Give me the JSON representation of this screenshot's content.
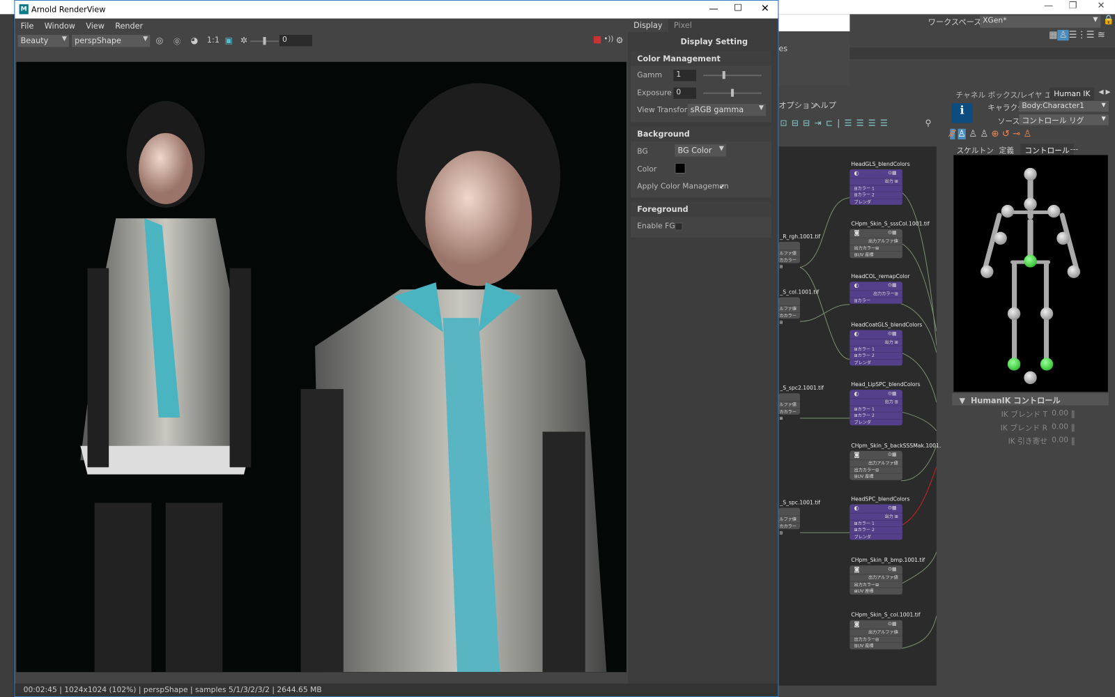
{
  "render_view": {
    "title": "Arnold RenderView",
    "window_controls": [
      "—",
      "☐",
      "✕"
    ],
    "menu": [
      "File",
      "Window",
      "View",
      "Render"
    ],
    "toolbar": {
      "aov": "Beauty",
      "camera": "perspShape",
      "ratio": "1:1",
      "exposure_value": "0"
    },
    "status": "00:02:45 | 1024x1024 (102%) | perspShape  | samples 5/1/3/2/3/2 | 2644.65 MB"
  },
  "display_panel": {
    "tabs": [
      "Display",
      "Pixel"
    ],
    "heading": "Display Setting",
    "color_management": {
      "title": "Color Management",
      "gamma_label": "Gamm",
      "gamma": "1",
      "gamma_slider": 0.35,
      "exposure_label": "Exposure",
      "exposure": "0",
      "exposure_slider": 0.5,
      "view_transform_label": "View Transform",
      "view_transform": "sRGB gamma"
    },
    "background": {
      "title": "Background",
      "bg_label": "BG",
      "bg_value": "BG Color",
      "color_label": "Color",
      "color": "#000000",
      "apply_label": "Apply Color Managemen",
      "apply_checked": true
    },
    "foreground": {
      "title": "Foreground",
      "enable_label": "Enable FG",
      "enable_checked": false
    }
  },
  "maya": {
    "window_controls": [
      "—",
      "❐",
      "✕"
    ],
    "workspace_label": "ワークスペース:",
    "workspace": "XGen*",
    "popup_text": "es",
    "node_editor_menu": [
      "オプション",
      "ヘルプ"
    ],
    "nodes": [
      {
        "name": "HeadGLS_blendColors",
        "type": "blend",
        "rows": [
          "出力 ⊞",
          "⊞カラー 1",
          "⊞カラー 2",
          "ブレンダ"
        ]
      },
      {
        "name": "CHpm_Skin_S_sssCol.1001.tif",
        "type": "file",
        "rows": [
          "出力アルファ値",
          "出力カラー⊞",
          "⊞UV 座標"
        ]
      },
      {
        "name": "HeadCOL_remapColor",
        "type": "remap",
        "rows": [
          "出力カラー⊞",
          "⊞カラー"
        ]
      },
      {
        "name": "HeadCoatGLS_blendColors",
        "type": "blend",
        "rows": [
          "出力 ⊞",
          "⊞カラー 1",
          "⊞カラー 2",
          "ブレンダ"
        ]
      },
      {
        "name": "Head_LipSPC_blendColors",
        "type": "blend",
        "rows": [
          "出力 ⊞",
          "⊞カラー 1",
          "⊞カラー 2",
          "ブレンダ"
        ]
      },
      {
        "name": "CHpm_Skin_S_backSSSMak.1001.",
        "type": "file",
        "rows": [
          "出力アルファ値",
          "出力カラー⊞",
          "⊞UV 座標"
        ]
      },
      {
        "name": "HeadSPC_blendColors",
        "type": "blend",
        "rows": [
          "出力 ⊞",
          "⊞カラー 1",
          "⊞カラー 2",
          "ブレンダ"
        ]
      },
      {
        "name": "CHpm_Skin_R_bmp.1001.tif",
        "type": "file",
        "rows": [
          "出力アルファ値",
          "出力カラー⊞",
          "⊞UV 座標"
        ]
      },
      {
        "name": "CHpm_Skin_S_col.1001.tif",
        "type": "file",
        "rows": [
          "出力アルファ値",
          "出力カラー⊞",
          "⊞UV 座標"
        ]
      }
    ],
    "left_nodes": [
      {
        "name": "_R_rgh.1001.tif",
        "rows": [
          "ルファ値",
          "カカラー⊞"
        ]
      },
      {
        "name": "_S_col.1001.tif",
        "rows": [
          "ルファ値",
          "カカラー⊞"
        ]
      },
      {
        "name": "_S_spc2.1001.tif",
        "rows": [
          "ルファ値",
          "カカラー⊞"
        ]
      },
      {
        "name": "_S_spc.1001.tif",
        "rows": [
          "ルファ値",
          "カカラー⊞"
        ]
      }
    ],
    "humanik": {
      "tabs": [
        "チャネル ボックス/レイヤ エディタ",
        "Human IK"
      ],
      "character_label": "キャラクタ:",
      "character": "Body:Character1",
      "source_label": "ソース:",
      "source": "コントロール リグ",
      "subtabs": [
        "スケルトン",
        "定義",
        "コントロール",
        "---"
      ],
      "controls_title": "HumanIK コントロール",
      "params": [
        {
          "label": "IK ブレンド T",
          "value": "0.00"
        },
        {
          "label": "IK ブレンド R",
          "value": "0.00"
        },
        {
          "label": "IK 引き寄せ",
          "value": "0.00"
        }
      ]
    }
  }
}
